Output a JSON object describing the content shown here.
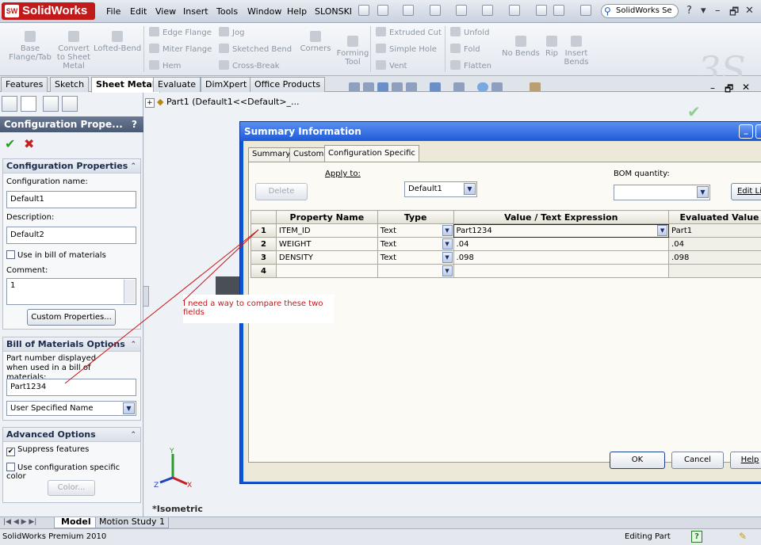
{
  "app": {
    "logo_text": "SolidWorks",
    "logo_badge": "SW",
    "menu": [
      "File",
      "Edit",
      "View",
      "Insert",
      "Tools",
      "Window",
      "Help",
      "SLONSKI"
    ],
    "search_placeholder": "SolidWorks Se",
    "window_controls": [
      "?",
      "▾",
      "–",
      "🗗",
      "✕"
    ]
  },
  "ribbon": {
    "big_items": [
      {
        "label": "Base\nFlange/Tab"
      },
      {
        "label": "Convert\nto Sheet\nMetal"
      },
      {
        "label": "Lofted-Bend"
      },
      {
        "label": "Corners"
      },
      {
        "label": "Forming\nTool"
      },
      {
        "label": "No Bends"
      },
      {
        "label": "Rip"
      },
      {
        "label": "Insert\nBends"
      }
    ],
    "small_col1": [
      "Edge Flange",
      "Miter Flange",
      "Hem"
    ],
    "small_col2": [
      "Jog",
      "Sketched Bend",
      "Cross-Break"
    ],
    "small_col3": [
      "Extruded Cut",
      "Simple Hole",
      "Vent"
    ],
    "small_col4": [
      "Unfold",
      "Fold",
      "Flatten"
    ]
  },
  "tabs": [
    "Features",
    "Sketch",
    "Sheet Metal",
    "Evaluate",
    "DimXpert",
    "Office Products"
  ],
  "active_tab": "Sheet Metal",
  "doc_tree_label": "Part1  (Default1<<Default>_...",
  "property_manager": {
    "title": "Configuration Prope...",
    "help": "?",
    "config_props": {
      "header": "Configuration Properties",
      "name_label": "Configuration name:",
      "name_value": "Default1",
      "desc_label": "Description:",
      "desc_value": "Default2",
      "use_bom_label": "Use in bill of materials",
      "comment_label": "Comment:",
      "comment_value": "1",
      "custom_props_button": "Custom Properties..."
    },
    "bom_options": {
      "header": "Bill of Materials Options",
      "desc": "Part number displayed when used in a bill of materials:",
      "part_number": "Part1234",
      "name_source": "User Specified Name"
    },
    "advanced": {
      "header": "Advanced Options",
      "suppress_label": "Suppress features",
      "suppress_checked": "✔",
      "color_label": "Use configuration specific color",
      "color_button": "Color..."
    }
  },
  "graphics": {
    "view_label": "*Isometric",
    "triad": {
      "x": "X",
      "y": "Y",
      "z": "Z"
    }
  },
  "callout_text": "I need a way to compare these two fields",
  "dialog": {
    "title": "Summary Information",
    "tabs": [
      "Summary",
      "Custom",
      "Configuration Specific"
    ],
    "active_tab": "Configuration Specific",
    "apply_to_label": "Apply to:",
    "delete_button": "Delete",
    "apply_to_value": "Default1",
    "bom_qty_label": "BOM quantity:",
    "edit_list_button": "Edit List",
    "columns": [
      "",
      "Property Name",
      "Type",
      "Value / Text Expression",
      "Evaluated Value"
    ],
    "rows": [
      {
        "num": "1",
        "name": "ITEM_ID",
        "type": "Text",
        "value": "Part1234",
        "evaluated": "Part1"
      },
      {
        "num": "2",
        "name": "WEIGHT",
        "type": "Text",
        "value": ".04",
        "evaluated": ".04"
      },
      {
        "num": "3",
        "name": "DENSITY",
        "type": "Text",
        "value": ".098",
        "evaluated": ".098"
      },
      {
        "num": "4",
        "name": "",
        "type": "",
        "value": "",
        "evaluated": ""
      }
    ],
    "ok_button": "OK",
    "cancel_button": "Cancel",
    "help_button": "Help"
  },
  "bottom_tabs": [
    "Model",
    "Motion Study 1"
  ],
  "status": {
    "left": "SolidWorks Premium 2010",
    "mode": "Editing Part",
    "help": "?"
  },
  "colors": {
    "dialog_title": "#1f5bd8",
    "callout_text": "#c91414",
    "brand": "#c21a1a"
  }
}
